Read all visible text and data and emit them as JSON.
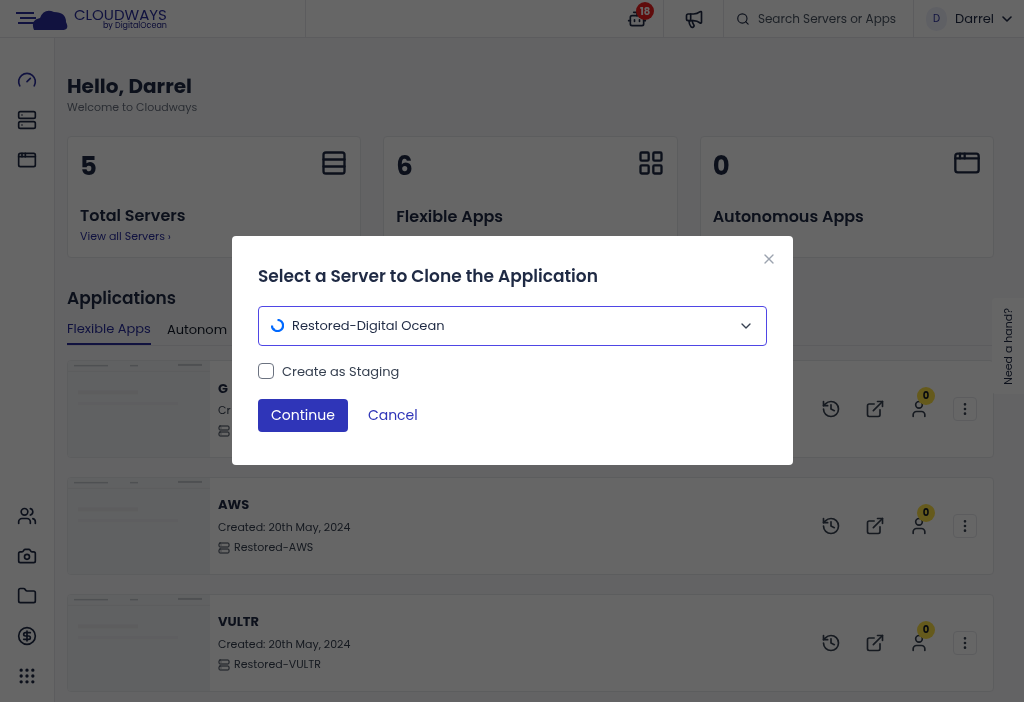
{
  "header": {
    "logo": "CLOUDWAYS",
    "logo_sub": "by DigitalOcean",
    "notifications": "18",
    "search": {
      "placeholder": "Search Servers or Apps"
    },
    "user": {
      "initial": "D",
      "name": "Darrel"
    }
  },
  "greeting": {
    "title": "Hello, Darrel",
    "subtitle": "Welcome to Cloudways"
  },
  "stats": [
    {
      "kind": "servers",
      "value": "5",
      "label": "Total Servers",
      "link": "View all Servers ›"
    },
    {
      "kind": "apps",
      "value": "6",
      "label": "Flexible Apps"
    },
    {
      "kind": "window",
      "value": "0",
      "label": "Autonomous Apps"
    }
  ],
  "applications": {
    "title": "Applications",
    "tabs": [
      {
        "label": "Flexible Apps",
        "selected": true
      },
      {
        "label": "Autonom",
        "selected": false
      }
    ],
    "apps": [
      {
        "name": "G",
        "created": "Cr",
        "badge": "0"
      },
      {
        "name": "AWS",
        "created": "Created: 20th May, 2024",
        "server": "Restored-AWS",
        "badge": "0"
      },
      {
        "name": "VULTR",
        "created": "Created: 20th May, 2024",
        "server": "Restored-VULTR",
        "badge": "0"
      }
    ]
  },
  "help_tab": "Need a hand?",
  "modal": {
    "title": "Select a Server to Clone the Application",
    "server": "Restored-Digital Ocean",
    "staging": {
      "label": "Create as Staging",
      "checked": false
    },
    "continue": "Continue",
    "cancel": "Cancel"
  }
}
